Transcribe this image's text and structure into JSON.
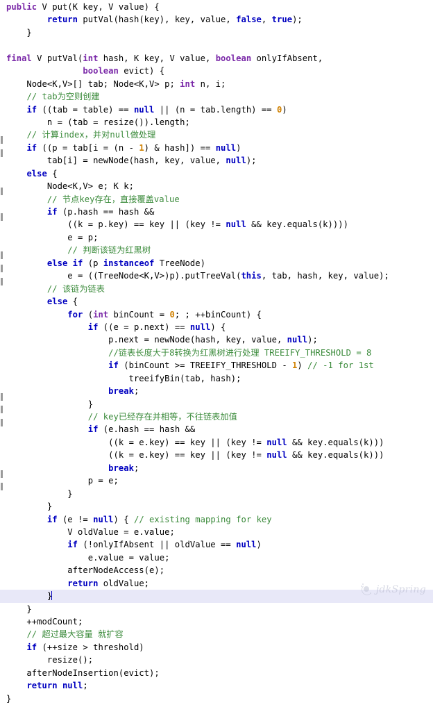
{
  "editor": {
    "language": "java",
    "current_line_index": 46,
    "colors": {
      "background": "#ffffff",
      "foreground": "#000000",
      "keyword": "#0000c0",
      "modifier": "#7a28a8",
      "number": "#d08000",
      "comment": "#3a8a3a",
      "current_line_highlight": "#e8e8f8",
      "gutter_fold_mark": "#9a9a9a",
      "watermark": "#b9bcd0"
    },
    "fold_marks_y": [
      196,
      215,
      270,
      307,
      362,
      381,
      400,
      566,
      584,
      603,
      677,
      695
    ]
  },
  "watermark": {
    "label": "jdkSpring",
    "logo_icon": "circle-sparkle-icon"
  },
  "code": {
    "lines": [
      [
        {
          "t": "public",
          "c": "mod"
        },
        {
          "t": " V put(K key, V value) {",
          "c": "plain"
        }
      ],
      [
        {
          "t": "        ",
          "c": "plain"
        },
        {
          "t": "return",
          "c": "kw"
        },
        {
          "t": " putVal(hash(key), key, value, ",
          "c": "plain"
        },
        {
          "t": "false",
          "c": "kw"
        },
        {
          "t": ", ",
          "c": "plain"
        },
        {
          "t": "true",
          "c": "kw"
        },
        {
          "t": ");",
          "c": "plain"
        }
      ],
      [
        {
          "t": "    }",
          "c": "plain"
        }
      ],
      [
        {
          "t": "",
          "c": "plain"
        }
      ],
      [
        {
          "t": "final",
          "c": "mod"
        },
        {
          "t": " V putVal(",
          "c": "plain"
        },
        {
          "t": "int",
          "c": "mod"
        },
        {
          "t": " hash, K key, V value, ",
          "c": "plain"
        },
        {
          "t": "boolean",
          "c": "mod"
        },
        {
          "t": " onlyIfAbsent,",
          "c": "plain"
        }
      ],
      [
        {
          "t": "               ",
          "c": "plain"
        },
        {
          "t": "boolean",
          "c": "mod"
        },
        {
          "t": " evict) {",
          "c": "plain"
        }
      ],
      [
        {
          "t": "    Node<K,V>[] tab; Node<K,V> p; ",
          "c": "plain"
        },
        {
          "t": "int",
          "c": "mod"
        },
        {
          "t": " n, i;",
          "c": "plain"
        }
      ],
      [
        {
          "t": "    ",
          "c": "plain"
        },
        {
          "t": "// tab为空则创建",
          "c": "cmt"
        }
      ],
      [
        {
          "t": "    ",
          "c": "plain"
        },
        {
          "t": "if",
          "c": "kw"
        },
        {
          "t": " ((tab = table) == ",
          "c": "plain"
        },
        {
          "t": "null",
          "c": "kw"
        },
        {
          "t": " || (n = tab.length) == ",
          "c": "plain"
        },
        {
          "t": "0",
          "c": "num"
        },
        {
          "t": ")",
          "c": "plain"
        }
      ],
      [
        {
          "t": "        n = (tab = resize()).length;",
          "c": "plain"
        }
      ],
      [
        {
          "t": "    ",
          "c": "plain"
        },
        {
          "t": "// 计算index，并对null做处理",
          "c": "cmt"
        }
      ],
      [
        {
          "t": "    ",
          "c": "plain"
        },
        {
          "t": "if",
          "c": "kw"
        },
        {
          "t": " ((p = tab[i = (n - ",
          "c": "plain"
        },
        {
          "t": "1",
          "c": "num"
        },
        {
          "t": ") & hash]) == ",
          "c": "plain"
        },
        {
          "t": "null",
          "c": "kw"
        },
        {
          "t": ")",
          "c": "plain"
        }
      ],
      [
        {
          "t": "        tab[i] = newNode(hash, key, value, ",
          "c": "plain"
        },
        {
          "t": "null",
          "c": "kw"
        },
        {
          "t": ");",
          "c": "plain"
        }
      ],
      [
        {
          "t": "    ",
          "c": "plain"
        },
        {
          "t": "else",
          "c": "kw"
        },
        {
          "t": " {",
          "c": "plain"
        }
      ],
      [
        {
          "t": "        Node<K,V> e; K k;",
          "c": "plain"
        }
      ],
      [
        {
          "t": "        ",
          "c": "plain"
        },
        {
          "t": "// 节点key存在，直接覆盖value",
          "c": "cmt"
        }
      ],
      [
        {
          "t": "        ",
          "c": "plain"
        },
        {
          "t": "if",
          "c": "kw"
        },
        {
          "t": " (p.hash == hash &&",
          "c": "plain"
        }
      ],
      [
        {
          "t": "            ((k = p.key) == key || (key != ",
          "c": "plain"
        },
        {
          "t": "null",
          "c": "kw"
        },
        {
          "t": " && key.equals(k))))",
          "c": "plain"
        }
      ],
      [
        {
          "t": "            e = p;",
          "c": "plain"
        }
      ],
      [
        {
          "t": "            ",
          "c": "plain"
        },
        {
          "t": "// 判断该链为红黑树",
          "c": "cmt"
        }
      ],
      [
        {
          "t": "        ",
          "c": "plain"
        },
        {
          "t": "else",
          "c": "kw"
        },
        {
          "t": " ",
          "c": "plain"
        },
        {
          "t": "if",
          "c": "kw"
        },
        {
          "t": " (p ",
          "c": "plain"
        },
        {
          "t": "instanceof",
          "c": "kw"
        },
        {
          "t": " TreeNode)",
          "c": "plain"
        }
      ],
      [
        {
          "t": "            e = ((TreeNode<K,V>)p).putTreeVal(",
          "c": "plain"
        },
        {
          "t": "this",
          "c": "kw"
        },
        {
          "t": ", tab, hash, key, value);",
          "c": "plain"
        }
      ],
      [
        {
          "t": "        ",
          "c": "plain"
        },
        {
          "t": "// 该链为链表",
          "c": "cmt"
        }
      ],
      [
        {
          "t": "        ",
          "c": "plain"
        },
        {
          "t": "else",
          "c": "kw"
        },
        {
          "t": " {",
          "c": "plain"
        }
      ],
      [
        {
          "t": "            ",
          "c": "plain"
        },
        {
          "t": "for",
          "c": "kw"
        },
        {
          "t": " (",
          "c": "plain"
        },
        {
          "t": "int",
          "c": "mod"
        },
        {
          "t": " binCount = ",
          "c": "plain"
        },
        {
          "t": "0",
          "c": "num"
        },
        {
          "t": "; ; ++binCount) {",
          "c": "plain"
        }
      ],
      [
        {
          "t": "                ",
          "c": "plain"
        },
        {
          "t": "if",
          "c": "kw"
        },
        {
          "t": " ((e = p.next) == ",
          "c": "plain"
        },
        {
          "t": "null",
          "c": "kw"
        },
        {
          "t": ") {",
          "c": "plain"
        }
      ],
      [
        {
          "t": "                    p.next = newNode(hash, key, value, ",
          "c": "plain"
        },
        {
          "t": "null",
          "c": "kw"
        },
        {
          "t": ");",
          "c": "plain"
        }
      ],
      [
        {
          "t": "                    ",
          "c": "plain"
        },
        {
          "t": "//链表长度大于8转换为红黑树进行处理 TREEIFY_THRESHOLD = 8",
          "c": "cmt"
        }
      ],
      [
        {
          "t": "                    ",
          "c": "plain"
        },
        {
          "t": "if",
          "c": "kw"
        },
        {
          "t": " (binCount >= TREEIFY_THRESHOLD - ",
          "c": "plain"
        },
        {
          "t": "1",
          "c": "num"
        },
        {
          "t": ") ",
          "c": "plain"
        },
        {
          "t": "// -1 for 1st",
          "c": "cmt"
        }
      ],
      [
        {
          "t": "                        treeifyBin(tab, hash);",
          "c": "plain"
        }
      ],
      [
        {
          "t": "                    ",
          "c": "plain"
        },
        {
          "t": "break",
          "c": "kw"
        },
        {
          "t": ";",
          "c": "plain"
        }
      ],
      [
        {
          "t": "                }",
          "c": "plain"
        }
      ],
      [
        {
          "t": "                ",
          "c": "plain"
        },
        {
          "t": "// key已经存在并相等，不往链表加值",
          "c": "cmt"
        }
      ],
      [
        {
          "t": "                ",
          "c": "plain"
        },
        {
          "t": "if",
          "c": "kw"
        },
        {
          "t": " (e.hash == hash &&",
          "c": "plain"
        }
      ],
      [
        {
          "t": "                    ((k = e.key) == key || (key != ",
          "c": "plain"
        },
        {
          "t": "null",
          "c": "kw"
        },
        {
          "t": " && key.equals(k)))",
          "c": "plain"
        }
      ],
      [
        {
          "t": "                    ((k = e.key) == key || (key != ",
          "c": "plain"
        },
        {
          "t": "null",
          "c": "kw"
        },
        {
          "t": " && key.equals(k)))",
          "c": "plain"
        }
      ],
      [
        {
          "t": "                    ",
          "c": "plain"
        },
        {
          "t": "break",
          "c": "kw"
        },
        {
          "t": ";",
          "c": "plain"
        }
      ],
      [
        {
          "t": "                p = e;",
          "c": "plain"
        }
      ],
      [
        {
          "t": "            }",
          "c": "plain"
        }
      ],
      [
        {
          "t": "        }",
          "c": "plain"
        }
      ],
      [
        {
          "t": "        ",
          "c": "plain"
        },
        {
          "t": "if",
          "c": "kw"
        },
        {
          "t": " (e != ",
          "c": "plain"
        },
        {
          "t": "null",
          "c": "kw"
        },
        {
          "t": ") { ",
          "c": "plain"
        },
        {
          "t": "// existing mapping for key",
          "c": "cmt"
        }
      ],
      [
        {
          "t": "            V oldValue = e.value;",
          "c": "plain"
        }
      ],
      [
        {
          "t": "            ",
          "c": "plain"
        },
        {
          "t": "if",
          "c": "kw"
        },
        {
          "t": " (!onlyIfAbsent || oldValue == ",
          "c": "plain"
        },
        {
          "t": "null",
          "c": "kw"
        },
        {
          "t": ")",
          "c": "plain"
        }
      ],
      [
        {
          "t": "                e.value = value;",
          "c": "plain"
        }
      ],
      [
        {
          "t": "            afterNodeAccess(e);",
          "c": "plain"
        }
      ],
      [
        {
          "t": "            ",
          "c": "plain"
        },
        {
          "t": "return",
          "c": "kw"
        },
        {
          "t": " oldValue;",
          "c": "plain"
        }
      ],
      [
        {
          "t": "        }",
          "c": "plain"
        }
      ],
      [
        {
          "t": "    }",
          "c": "plain"
        }
      ],
      [
        {
          "t": "    ++modCount;",
          "c": "plain"
        }
      ],
      [
        {
          "t": "    ",
          "c": "plain"
        },
        {
          "t": "// 超过最大容量 就扩容",
          "c": "cmt"
        }
      ],
      [
        {
          "t": "    ",
          "c": "plain"
        },
        {
          "t": "if",
          "c": "kw"
        },
        {
          "t": " (++size > threshold)",
          "c": "plain"
        }
      ],
      [
        {
          "t": "        resize();",
          "c": "plain"
        }
      ],
      [
        {
          "t": "    afterNodeInsertion(evict);",
          "c": "plain"
        }
      ],
      [
        {
          "t": "    ",
          "c": "plain"
        },
        {
          "t": "return",
          "c": "kw"
        },
        {
          "t": " ",
          "c": "plain"
        },
        {
          "t": "null",
          "c": "kw"
        },
        {
          "t": ";",
          "c": "plain"
        }
      ],
      [
        {
          "t": "}",
          "c": "plain"
        }
      ]
    ]
  }
}
